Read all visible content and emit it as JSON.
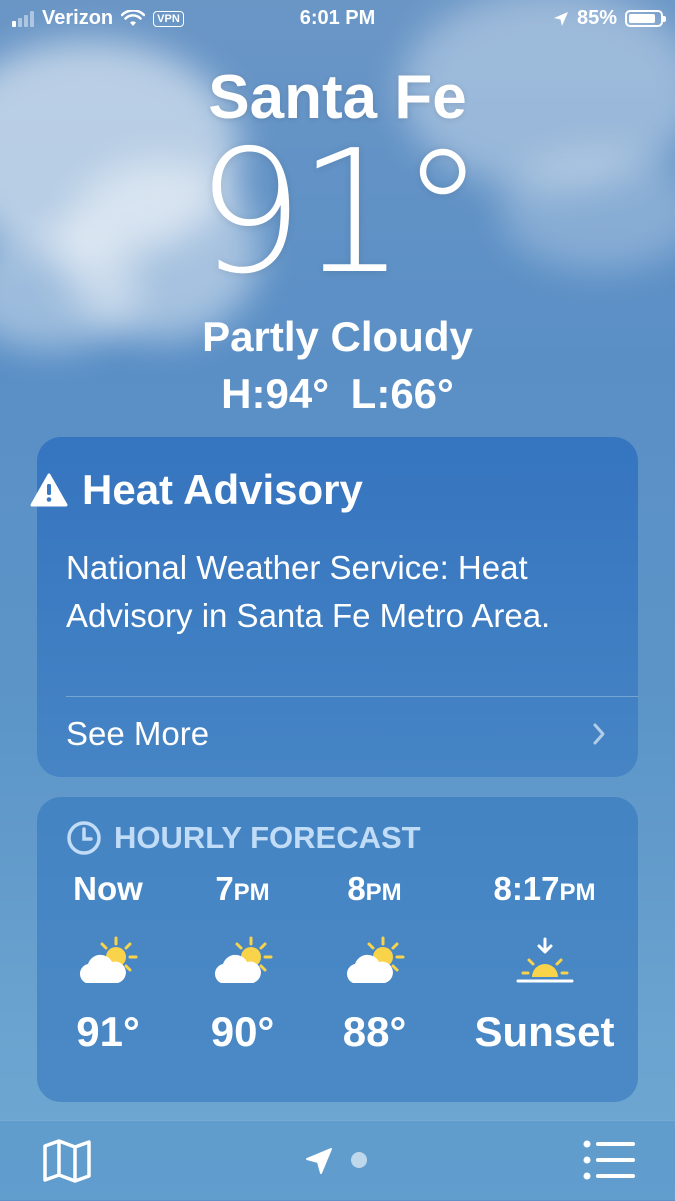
{
  "status_bar": {
    "carrier": "Verizon",
    "vpn": "VPN",
    "time": "6:01 PM",
    "battery_percent": "85%",
    "battery_level": 0.85
  },
  "current": {
    "city": "Santa Fe",
    "temperature": "91°",
    "condition": "Partly Cloudy",
    "high_low": "H:94°  L:66°"
  },
  "advisory": {
    "title": "Heat Advisory",
    "text": "National Weather Service: Heat Advisory in Santa Fe Metro Area.",
    "see_more": "See More"
  },
  "hourly": {
    "header": "HOURLY FORECAST",
    "items": [
      {
        "time": "Now",
        "suffix": "",
        "icon": "partly-cloudy-icon",
        "value": "91°"
      },
      {
        "time": "7",
        "suffix": "PM",
        "icon": "partly-cloudy-icon",
        "value": "90°"
      },
      {
        "time": "8",
        "suffix": "PM",
        "icon": "partly-cloudy-icon",
        "value": "88°"
      },
      {
        "time": "8:17",
        "suffix": "PM",
        "icon": "sunset-icon",
        "value": "Sunset"
      }
    ]
  },
  "toolbar": {
    "map_icon": "map-icon",
    "location_icon": "location-arrow-icon",
    "list_icon": "list-icon"
  },
  "colors": {
    "sun": "#f9d34a",
    "card": "#2f70be"
  }
}
